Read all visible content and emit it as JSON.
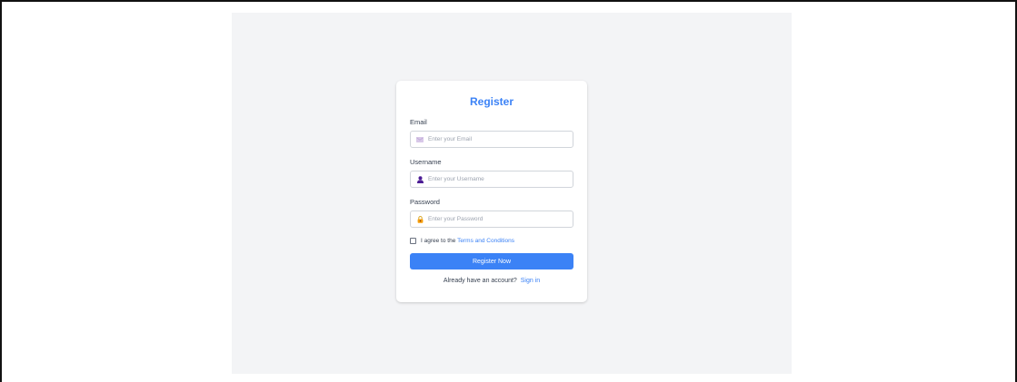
{
  "form": {
    "title": "Register",
    "fields": [
      {
        "label": "Email",
        "placeholder": "Enter your Email",
        "icon": "envelope-icon"
      },
      {
        "label": "Username",
        "placeholder": "Enter your Username",
        "icon": "user-icon"
      },
      {
        "label": "Password",
        "placeholder": "Enter your Password",
        "icon": "lock-icon"
      }
    ],
    "terms_prefix": "I agree to the ",
    "terms_link": "Terms and Conditions",
    "submit_label": "Register Now",
    "footer_text": "Already have an account? ",
    "signin_link": "Sign in"
  },
  "colors": {
    "accent": "#3b82f6",
    "panel_background": "#f3f4f6",
    "card_background": "#ffffff"
  }
}
